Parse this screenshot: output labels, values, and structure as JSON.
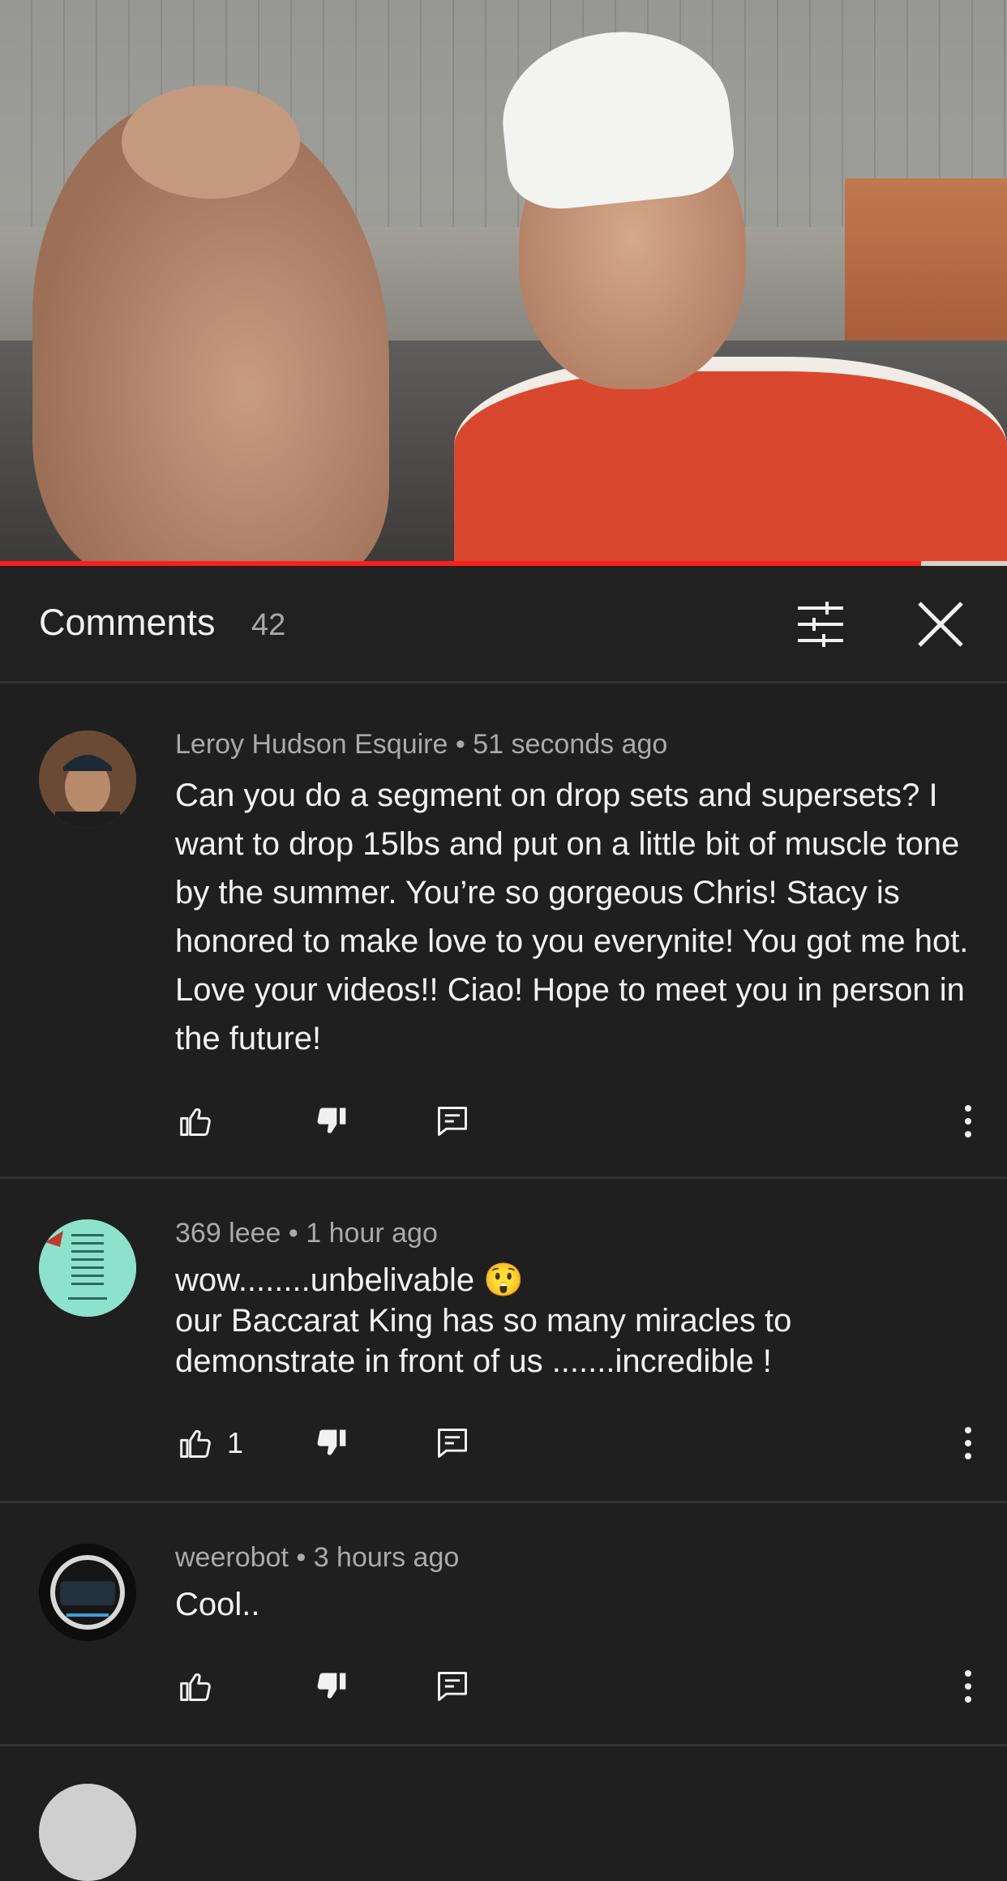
{
  "video": {
    "progress_percent": 91.5
  },
  "header": {
    "title": "Comments",
    "count": "42"
  },
  "comments": [
    {
      "author": "Leroy Hudson Esquire",
      "time": "51 seconds ago",
      "text": "Can you do a segment on drop sets and supersets? I want to drop 15lbs and put on a little bit of muscle tone by the summer. You’re so gorgeous Chris! Stacy is honored to make love to you everynite! You got me hot. Love your videos!! Ciao! Hope to meet you in person in the future!",
      "likes": ""
    },
    {
      "author": "369 leee",
      "time": "1 hour ago",
      "text_line1": "wow........unbelivable 😲",
      "text_line2": "our Baccarat King has so many miracles to demonstrate in front of us .......incredible !",
      "likes": "1"
    },
    {
      "author": "weerobot",
      "time": "3 hours ago",
      "text": "Cool..",
      "likes": ""
    }
  ],
  "separator": "•",
  "colors": {
    "background": "#1f1f1f",
    "divider": "#333333",
    "progress": "#ff1e1e",
    "secondary_text": "#aaaaaa"
  }
}
